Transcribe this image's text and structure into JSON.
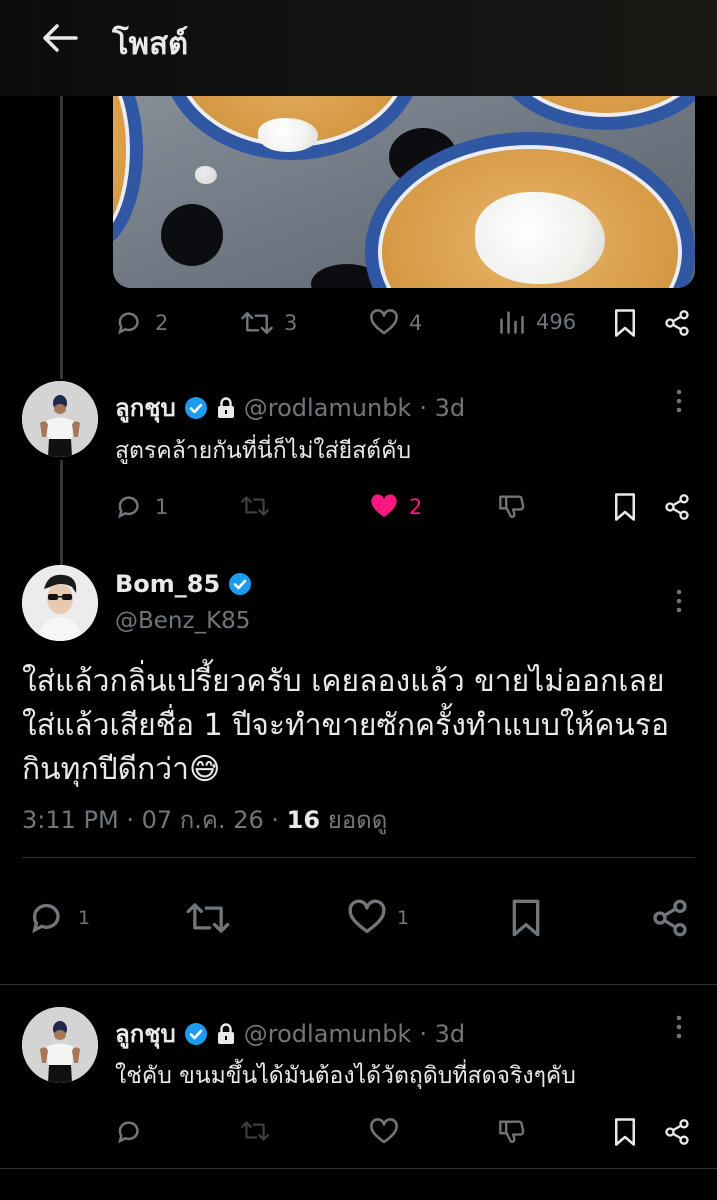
{
  "header": {
    "title": "โพสต์"
  },
  "first_post_actions": {
    "replies": "2",
    "reposts": "3",
    "likes": "4",
    "views": "496"
  },
  "reply1": {
    "name": "ลูกชุบ",
    "handle": "@rodlamunbk",
    "time": "· 3d",
    "text": "สูตรคล้ายกันที่นี่ก็ไม่ใส่ยีสต์คับ",
    "replies": "1",
    "likes": "2"
  },
  "main_post": {
    "name": "Bom_85",
    "handle": "@Benz_K85",
    "text_lines": [
      "ใส่แล้วกลิ่นเปรี้ยวครับ เคยลองแล้ว ขายไม่ออกเลย",
      "ใส่แล้วเสียชื่อ 1 ปีจะทำขายซักครั้งทำแบบให้คนรอ",
      "กินทุกปีดีกว่า😅"
    ],
    "timestamp": "3:11 PM · 07 ก.ค. 26 · ",
    "views_count": "16",
    "views_label": " ยอดดู",
    "replies": "1",
    "likes": "1"
  },
  "reply2": {
    "name": "ลูกชุบ",
    "handle": "@rodlamunbk",
    "time": "· 3d",
    "text": "ใช่คับ ขนมขึ้นได้มันต้องได้วัตถุดิบที่สดจริงๆคับ"
  },
  "colors": {
    "verified": "#1d9bf0",
    "like_active": "#f91880",
    "muted": "#71767b"
  }
}
